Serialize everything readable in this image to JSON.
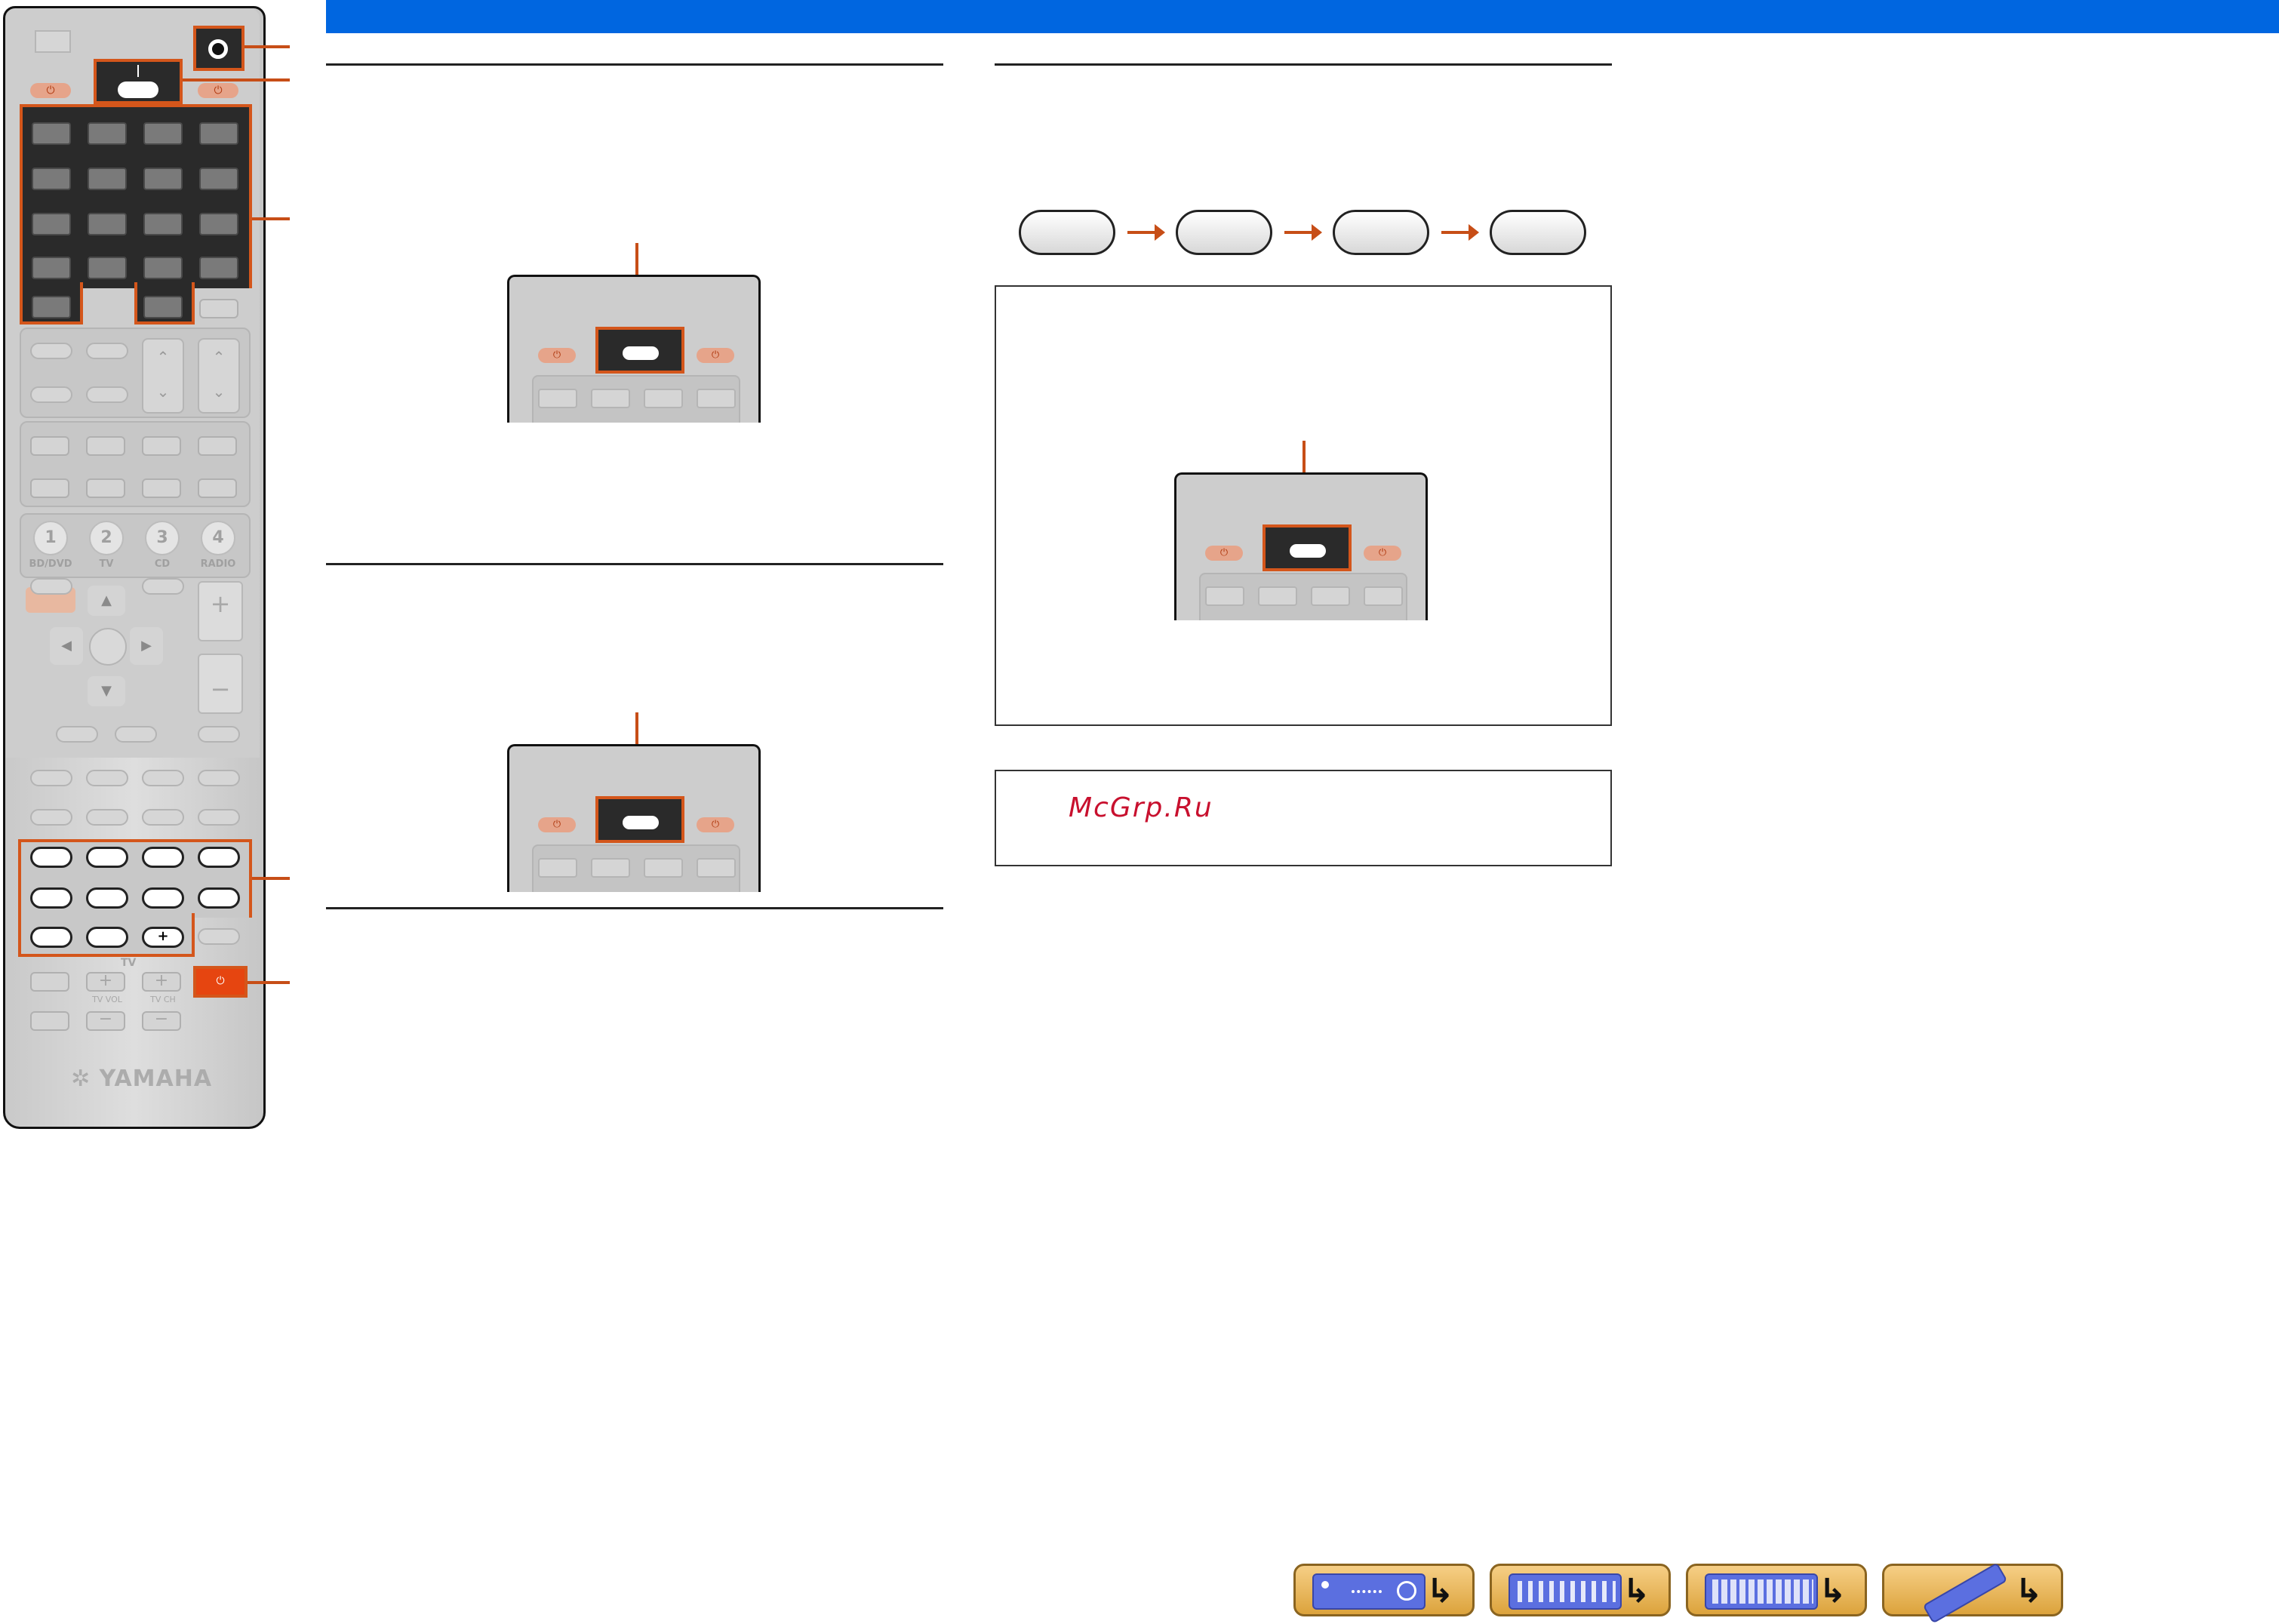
{
  "remote": {
    "brand": "YAMAHA",
    "number_buttons": [
      {
        "num": "1",
        "label": "BD/DVD"
      },
      {
        "num": "2",
        "label": "TV"
      },
      {
        "num": "3",
        "label": "CD"
      },
      {
        "num": "4",
        "label": "RADIO"
      }
    ],
    "tv_label": "TV",
    "tv_vol_label": "TV VOL",
    "tv_ch_label": "TV CH",
    "plus": "+",
    "minus": "−",
    "power_symbol": "⏻"
  },
  "watermark": "McGrp.Ru",
  "colors": {
    "accent": "#0066e0",
    "highlight": "#d4561b",
    "nav": "#e8b65a"
  },
  "nav_buttons": [
    {
      "icon": "receiver-front-panel-icon"
    },
    {
      "icon": "receiver-rear-panel-icon"
    },
    {
      "icon": "receiver-display-icon"
    },
    {
      "icon": "remote-control-icon"
    }
  ],
  "nav_return_glyph": "↳"
}
